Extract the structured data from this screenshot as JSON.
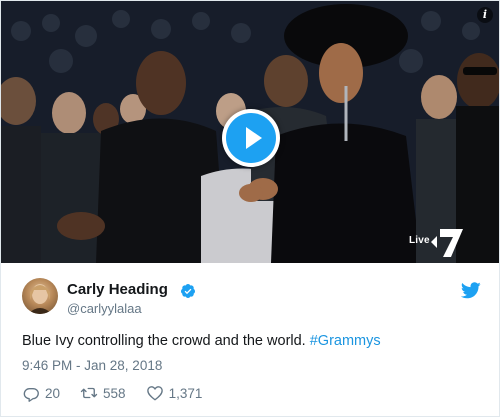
{
  "video": {
    "channel_logo_text": "Live",
    "channel_number": "7",
    "play_label": "Play video"
  },
  "tweet": {
    "author_name": "Carly Heading",
    "author_handle": "@carlyylalaa",
    "text_main": "Blue Ivy controlling the crowd and the world. ",
    "hashtag": "#Grammys",
    "timestamp": "9:46 PM - Jan 28, 2018",
    "replies": "20",
    "retweets": "558",
    "likes": "1,371"
  },
  "colors": {
    "accent": "#1da1f2",
    "link": "#1b95e0",
    "muted": "#657786",
    "text": "#14171a"
  },
  "icons": [
    "info-icon",
    "play-icon",
    "verified-badge-icon",
    "twitter-bird-icon",
    "reply-icon",
    "retweet-icon",
    "like-icon"
  ]
}
